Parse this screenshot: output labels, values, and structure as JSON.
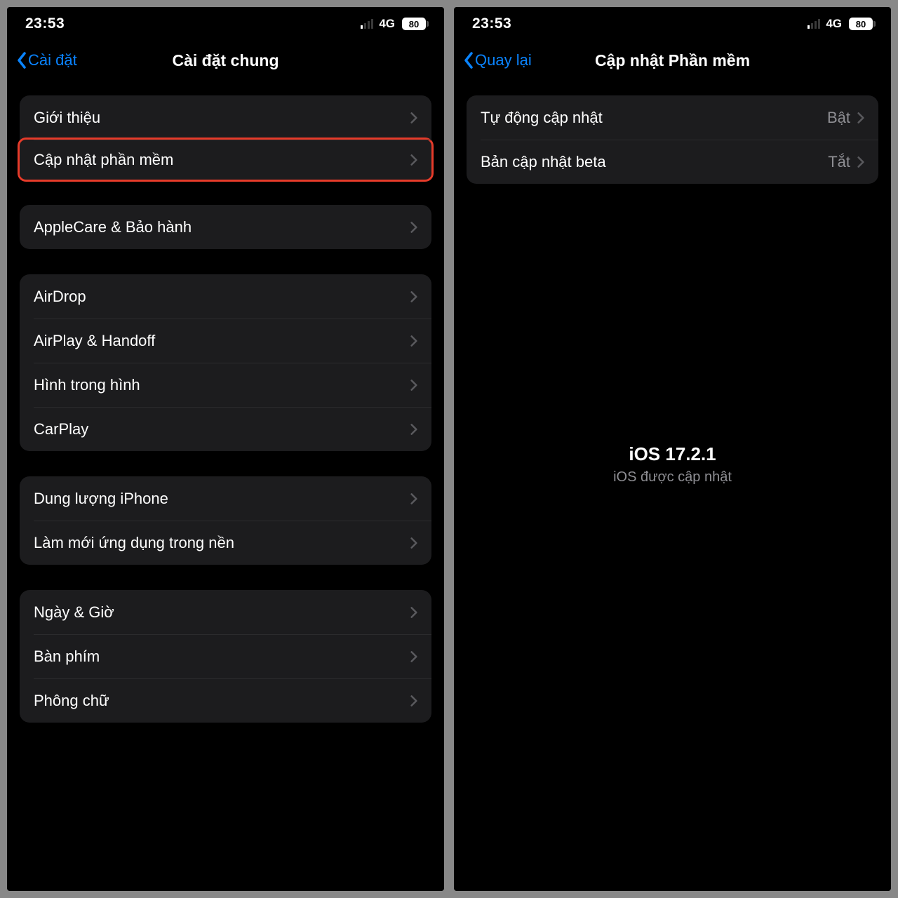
{
  "status": {
    "time": "23:53",
    "network": "4G",
    "battery": "80"
  },
  "left": {
    "back_label": "Cài đặt",
    "title": "Cài đặt chung",
    "g1": {
      "about": "Giới thiệu",
      "software_update": "Cập nhật phần mềm"
    },
    "g2": {
      "applecare": "AppleCare & Bảo hành"
    },
    "g3": {
      "airdrop": "AirDrop",
      "airplay": "AirPlay & Handoff",
      "pip": "Hình trong hình",
      "carplay": "CarPlay"
    },
    "g4": {
      "storage": "Dung lượng iPhone",
      "bg_refresh": "Làm mới ứng dụng trong nền"
    },
    "g5": {
      "date_time": "Ngày & Giờ",
      "keyboard": "Bàn phím",
      "fonts": "Phông chữ"
    }
  },
  "right": {
    "back_label": "Quay lại",
    "title": "Cập nhật Phần mềm",
    "rows": {
      "auto_update": {
        "label": "Tự động cập nhật",
        "value": "Bật"
      },
      "beta": {
        "label": "Bản cập nhật beta",
        "value": "Tắt"
      }
    },
    "ios_version": "iOS 17.2.1",
    "ios_status": "iOS được cập nhật"
  }
}
